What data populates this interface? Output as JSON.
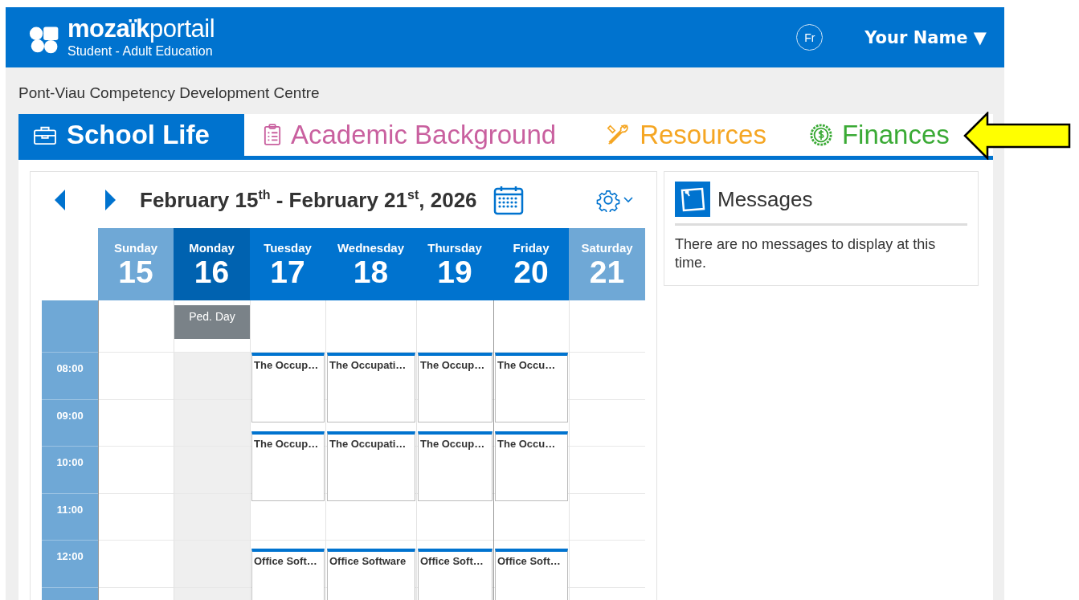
{
  "header": {
    "brand": "**mozaïk**portail",
    "subtitle": "Student - Adult Education",
    "language_button": "Fr",
    "user_menu": "Your Name ▼"
  },
  "school_name": "Pont-Viau Competency Development Centre",
  "tabs": [
    {
      "label": "School Life",
      "selected": true,
      "color": "#0073cf"
    },
    {
      "label": "Academic Background",
      "selected": false,
      "color": "#c9609f"
    },
    {
      "label": "Resources",
      "selected": false,
      "color": "#f5a623"
    },
    {
      "label": "Finances",
      "selected": false,
      "color": "#3aaa35"
    }
  ],
  "calendar": {
    "title": "February 15$^{th}$ - February 21$^{st}$, 2026",
    "times": [
      "08:00",
      "09:00",
      "10:00",
      "11:00",
      "12:00"
    ],
    "days": [
      {
        "name": "Sunday",
        "number": "15",
        "kind": "weekend",
        "selected": false
      },
      {
        "name": "Monday",
        "number": "16",
        "kind": "weekday",
        "selected": true,
        "all_day": "Ped. Day"
      },
      {
        "name": "Tuesday",
        "number": "17",
        "kind": "weekday",
        "selected": false,
        "events": [
          {
            "title": "The Occup…"
          },
          {
            "title": "The Occup…"
          },
          {
            "title": "Office Soft…"
          }
        ]
      },
      {
        "name": "Wednesday",
        "number": "18",
        "kind": "weekday",
        "selected": false,
        "events": [
          {
            "title": "The Occupati…"
          },
          {
            "title": "The Occupati…"
          },
          {
            "title": "Office Software"
          }
        ]
      },
      {
        "name": "Thursday",
        "number": "19",
        "kind": "weekday",
        "selected": false,
        "events": [
          {
            "title": "The Occup…"
          },
          {
            "title": "The Occup…"
          },
          {
            "title": "Office Soft…"
          }
        ]
      },
      {
        "name": "Friday",
        "number": "20",
        "kind": "weekday",
        "selected": false,
        "events": [
          {
            "title": "The Occu…"
          },
          {
            "title": "The Occu…"
          },
          {
            "title": "Office Soft…"
          }
        ]
      },
      {
        "name": "Saturday",
        "number": "21",
        "kind": "weekend",
        "selected": false
      }
    ]
  },
  "messages": {
    "title": "Messages",
    "text": "There are no messages to display at this time."
  }
}
